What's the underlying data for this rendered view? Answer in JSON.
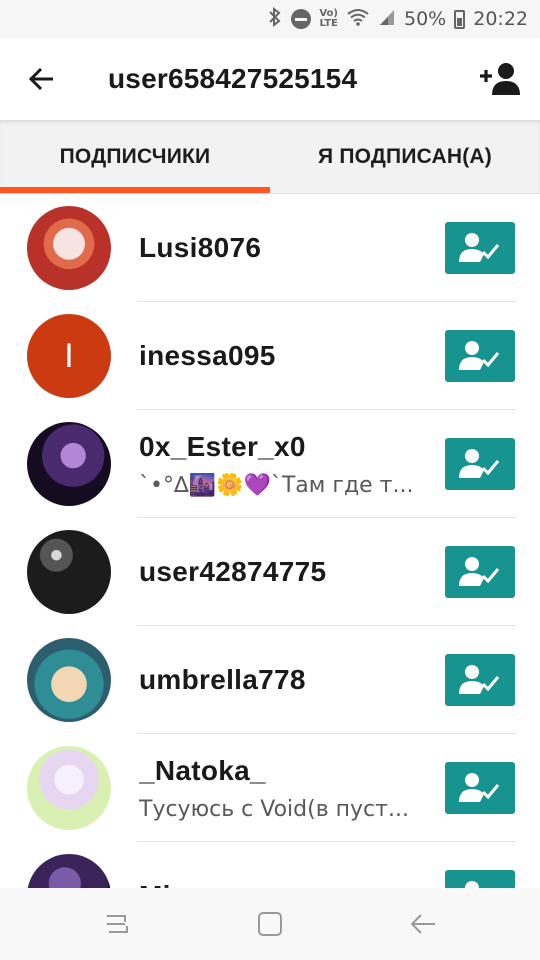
{
  "status_bar": {
    "icons": [
      "bluetooth-icon",
      "do-not-disturb-icon",
      "volte-icon",
      "wifi-icon",
      "signal-icon",
      "battery-icon"
    ],
    "volte_top": "Vo)",
    "volte_bottom": "LTE",
    "battery": "50%",
    "time": "20:22"
  },
  "app_bar": {
    "back_icon": "back-arrow-icon",
    "title": "user658427525154",
    "action_icon": "add-user-icon"
  },
  "tabs": [
    {
      "label": "ПОДПИСЧИКИ",
      "active": true
    },
    {
      "label": "Я ПОДПИСАН(А)",
      "active": false
    }
  ],
  "colors": {
    "accent": "#ff5722",
    "follow_button": "#17948f",
    "letter_avatar": "#cc3a12"
  },
  "users": [
    {
      "username": "Lusi8076",
      "bio": "",
      "avatar": "image"
    },
    {
      "username": "inessa095",
      "bio": "",
      "avatar": "letter",
      "avatar_letter": "I"
    },
    {
      "username": "0x_Ester_x0",
      "bio": "`•°∆🌆🌼💜`Там где т...",
      "avatar": "image"
    },
    {
      "username": "user42874775",
      "bio": "",
      "avatar": "image"
    },
    {
      "username": "umbrella778",
      "bio": "",
      "avatar": "image"
    },
    {
      "username": "_Natoka_",
      "bio": "Тусуюсь с Void(в пуст...",
      "avatar": "image"
    },
    {
      "username": "Mi...",
      "bio": "",
      "avatar": "image"
    }
  ],
  "follow_icon": "user-check-icon",
  "nav_bar": {
    "buttons": [
      "recent-apps-icon",
      "home-icon",
      "back-icon"
    ]
  }
}
